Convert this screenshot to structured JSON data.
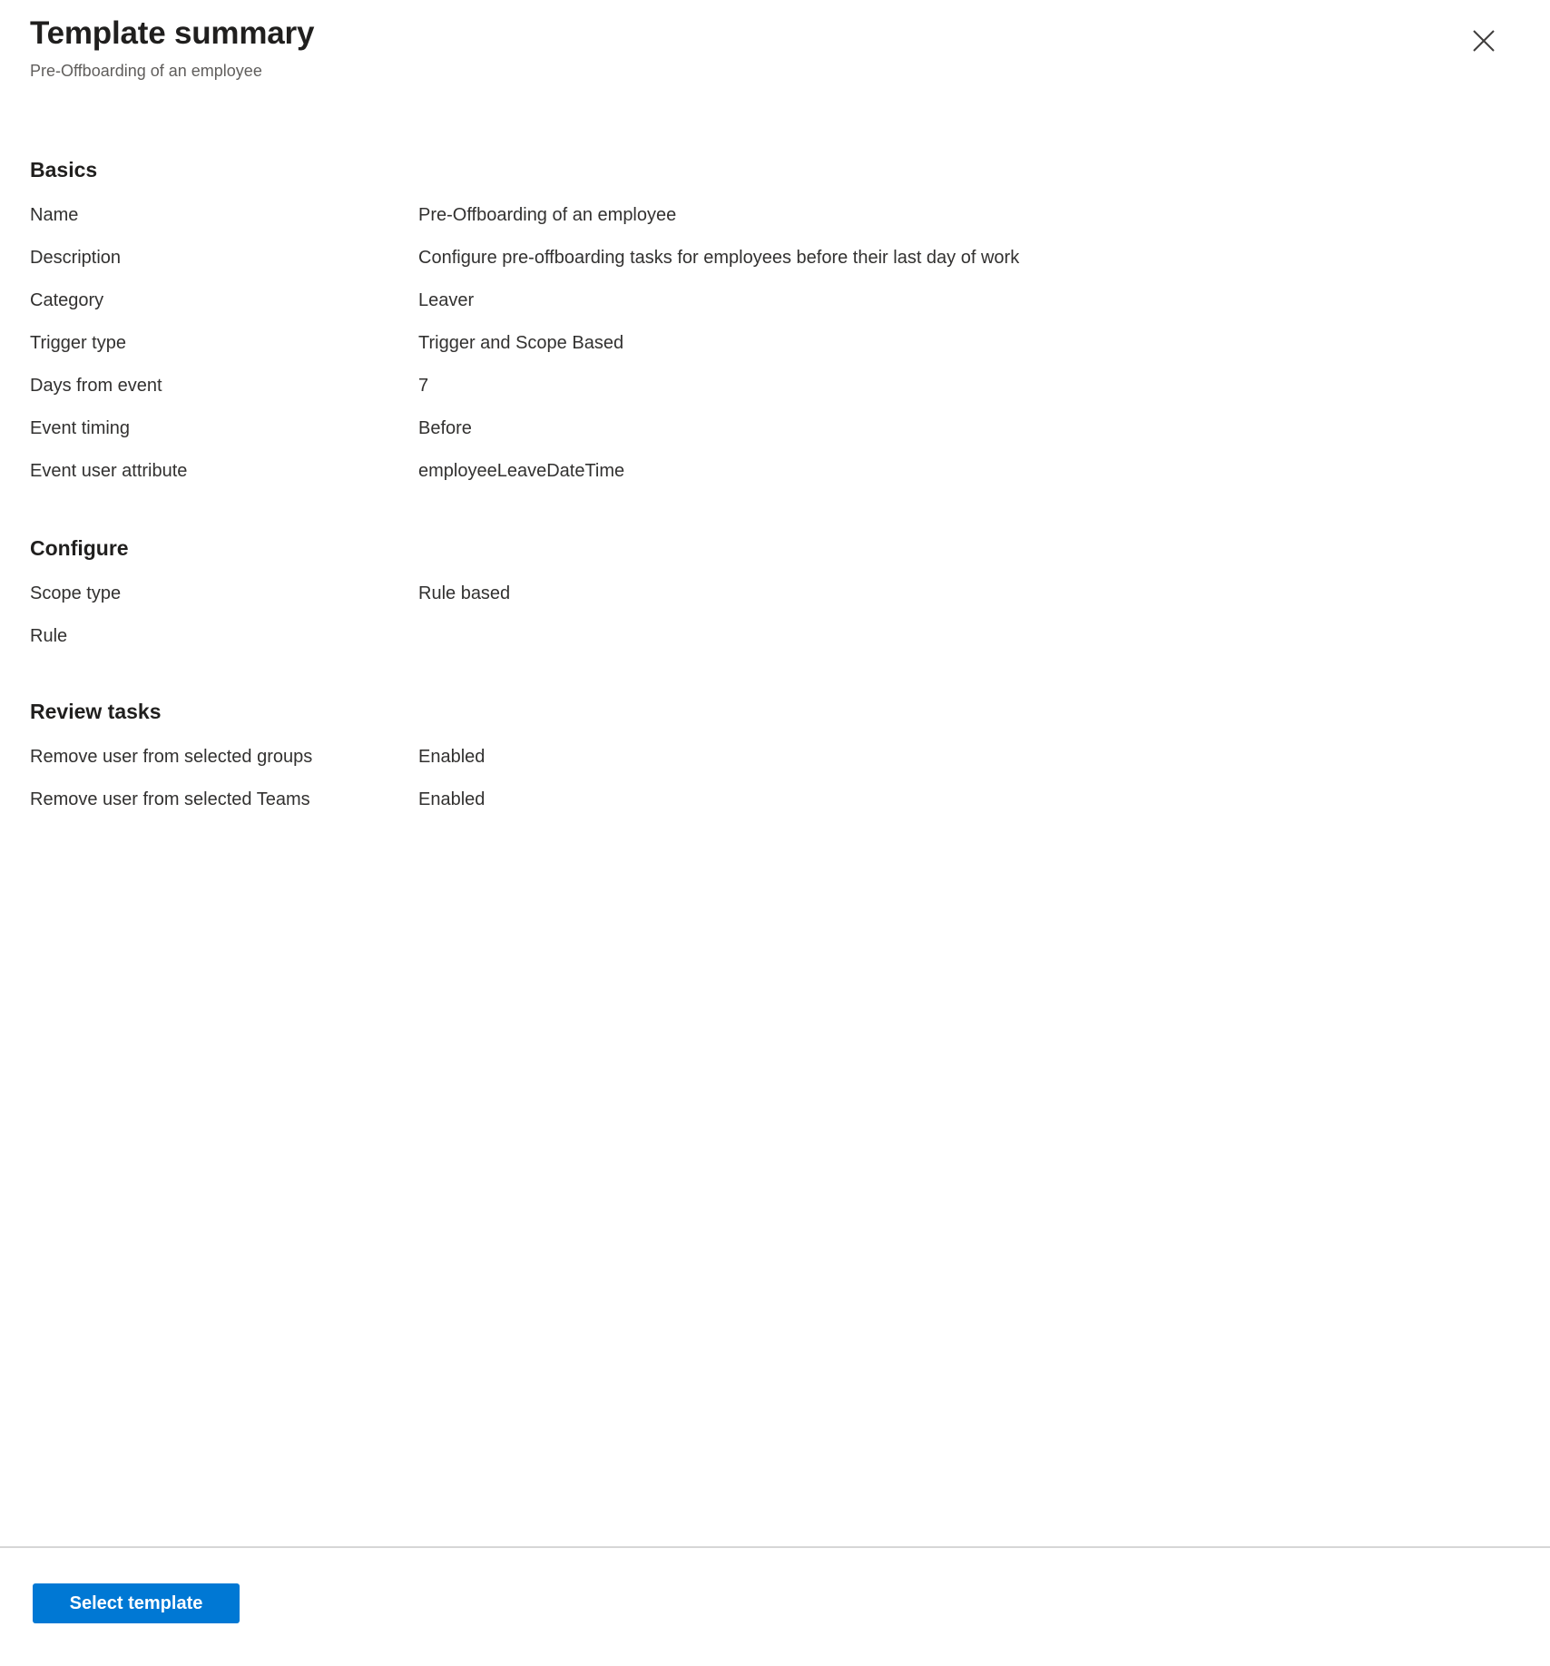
{
  "header": {
    "title": "Template summary",
    "subtitle": "Pre-Offboarding of an employee",
    "close_icon": "close-icon"
  },
  "sections": [
    {
      "heading": "Basics",
      "rows": [
        {
          "label": "Name",
          "value": "Pre-Offboarding of an employee"
        },
        {
          "label": "Description",
          "value": "Configure pre-offboarding tasks for employees before their last day of work"
        },
        {
          "label": "Category",
          "value": "Leaver"
        },
        {
          "label": "Trigger type",
          "value": "Trigger and Scope Based"
        },
        {
          "label": "Days from event",
          "value": "7"
        },
        {
          "label": "Event timing",
          "value": "Before"
        },
        {
          "label": "Event user attribute",
          "value": "employeeLeaveDateTime"
        }
      ]
    },
    {
      "heading": "Configure",
      "rows": [
        {
          "label": "Scope type",
          "value": "Rule based"
        },
        {
          "label": "Rule",
          "value": ""
        }
      ]
    },
    {
      "heading": "Review tasks",
      "rows": [
        {
          "label": "Remove user from selected groups",
          "value": "Enabled"
        },
        {
          "label": "Remove user from selected Teams",
          "value": "Enabled"
        }
      ]
    }
  ],
  "footer": {
    "select_template_label": "Select template"
  },
  "colors": {
    "accent": "#0078d4",
    "text_primary": "#201f1e",
    "text_secondary": "#605e5c",
    "divider": "#d6d6d6"
  }
}
